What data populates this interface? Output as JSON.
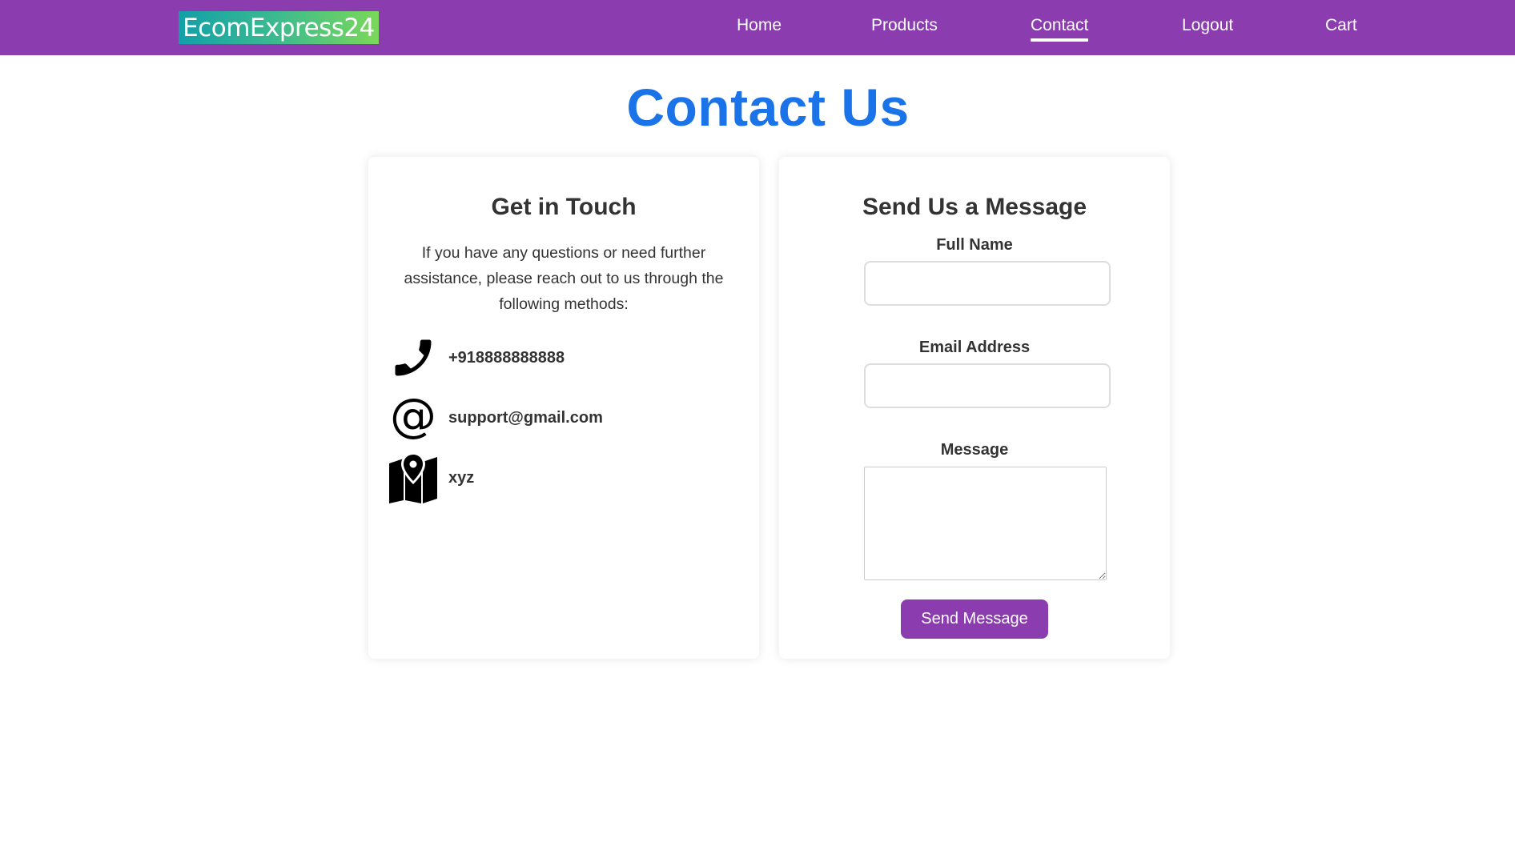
{
  "brand": {
    "logo_text": "EcomExpress24"
  },
  "nav": {
    "items": [
      {
        "label": "Home",
        "active": false
      },
      {
        "label": "Products",
        "active": false
      },
      {
        "label": "Contact",
        "active": true
      },
      {
        "label": "Logout",
        "active": false
      },
      {
        "label": "Cart",
        "active": false
      }
    ]
  },
  "page": {
    "title": "Contact Us"
  },
  "touch": {
    "heading": "Get in Touch",
    "description": "If you have any questions or need further assistance, please reach out to us through the following methods:",
    "contacts": [
      {
        "icon": "phone-icon",
        "value": "+918888888888"
      },
      {
        "icon": "at-sign-icon",
        "value": "support@gmail.com"
      },
      {
        "icon": "map-pin-icon",
        "value": "xyz"
      }
    ]
  },
  "form": {
    "heading": "Send Us a Message",
    "name_label": "Full Name",
    "name_value": "",
    "email_label": "Email Address",
    "email_value": "",
    "message_label": "Message",
    "message_value": "",
    "submit_label": "Send Message"
  },
  "colors": {
    "navbar": "#8b3caf",
    "title": "#1a73e8",
    "button": "#8b3caf",
    "logo_gradient": [
      "#12a0a8",
      "#7bd859"
    ]
  }
}
